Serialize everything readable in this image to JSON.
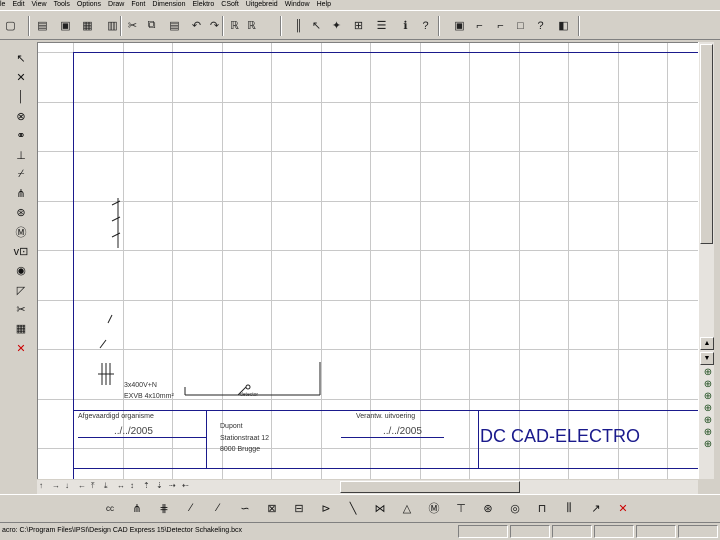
{
  "menu": [
    "le",
    "Edit",
    "View",
    "Tools",
    "Options",
    "Draw",
    "Font",
    "Dimension",
    "Elektro",
    "CSoft",
    "Uitgebreid",
    "Window",
    "Help"
  ],
  "title_block": {
    "left_label": "Afgevaardigd organisme",
    "left_date": "../../2005",
    "address_label": "Dupont",
    "street": "Stationstraat 12",
    "city": "8000 Brugge",
    "right_label": "Verantw. uitvoering",
    "right_date": "../../2005",
    "brand": "DC CAD-ELECTRO"
  },
  "circuit": {
    "supply_label": "3x400V+N",
    "cable_label": "EXVB 4x10mm²",
    "detector_label": "detector"
  },
  "status": {
    "macro_path": "acro: C:\\Program Files\\IPSI\\Design CAD Express 15\\Detector Schakeling.bcx"
  },
  "icons": {
    "top": [
      "new-icon",
      "open-icon",
      "save-icon",
      "print-icon",
      "preview-icon",
      "cut-icon",
      "copy-icon",
      "paste-icon",
      "undo-icon",
      "redo-icon",
      "zoom-r-icon",
      "zoom-l-icon",
      "line-tool-icon",
      "arrow-tool-icon",
      "node-tool-icon",
      "select-box-icon",
      "group-icon",
      "info-icon",
      "help-query-icon",
      "grid-icon",
      "snap-icon",
      "contact-icon",
      "box-icon",
      "question-icon",
      "lamp-icon"
    ],
    "left": [
      "pointer-icon",
      "cross-icon",
      "bar-icon",
      "circle-x-icon",
      "lamp-icon",
      "switch-icon",
      "double-switch-icon",
      "transistor-icon",
      "transformer-icon",
      "motor-icon",
      "meter-icon",
      "detector-icon",
      "fuse-icon",
      "scissors-icon",
      "table-icon",
      "delete-icon"
    ],
    "bottom": [
      "text-cc-icon",
      "contact-no-icon",
      "contact-nc-icon",
      "switch-a-icon",
      "switch-b-icon",
      "coil-icon",
      "relay-icon",
      "fuse-box-icon",
      "diode-icon",
      "wire-icon",
      "cross-wire-icon",
      "triangle-icon",
      "motor-icon",
      "terminal-icon",
      "lamp-icon",
      "target-icon",
      "resistor-icon",
      "capacitor-icon",
      "arrow-icon",
      "delete-icon"
    ]
  }
}
